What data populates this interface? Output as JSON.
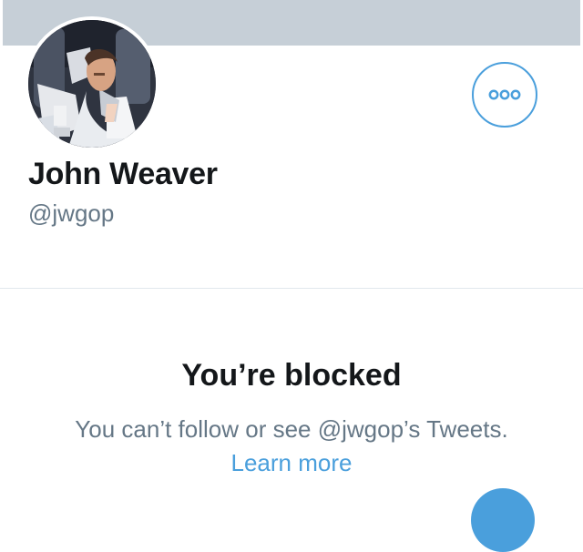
{
  "colors": {
    "banner": "#c6cfd7",
    "accent": "#4a9fdc",
    "primary_text": "#14171a",
    "secondary_text": "#657786",
    "divider": "#e1e8ed"
  },
  "header": {
    "banner": "profile-header-banner"
  },
  "profile": {
    "avatar_icon": "profile-photo",
    "more_icon": "more-options-icon",
    "name": "John Weaver",
    "handle": "@jwgop"
  },
  "blocked": {
    "title": "You’re blocked",
    "message": "You can’t follow or see @jwgop’s Tweets.",
    "learn_more": "Learn more"
  },
  "fab": {
    "icon": "compose-tweet-icon"
  }
}
